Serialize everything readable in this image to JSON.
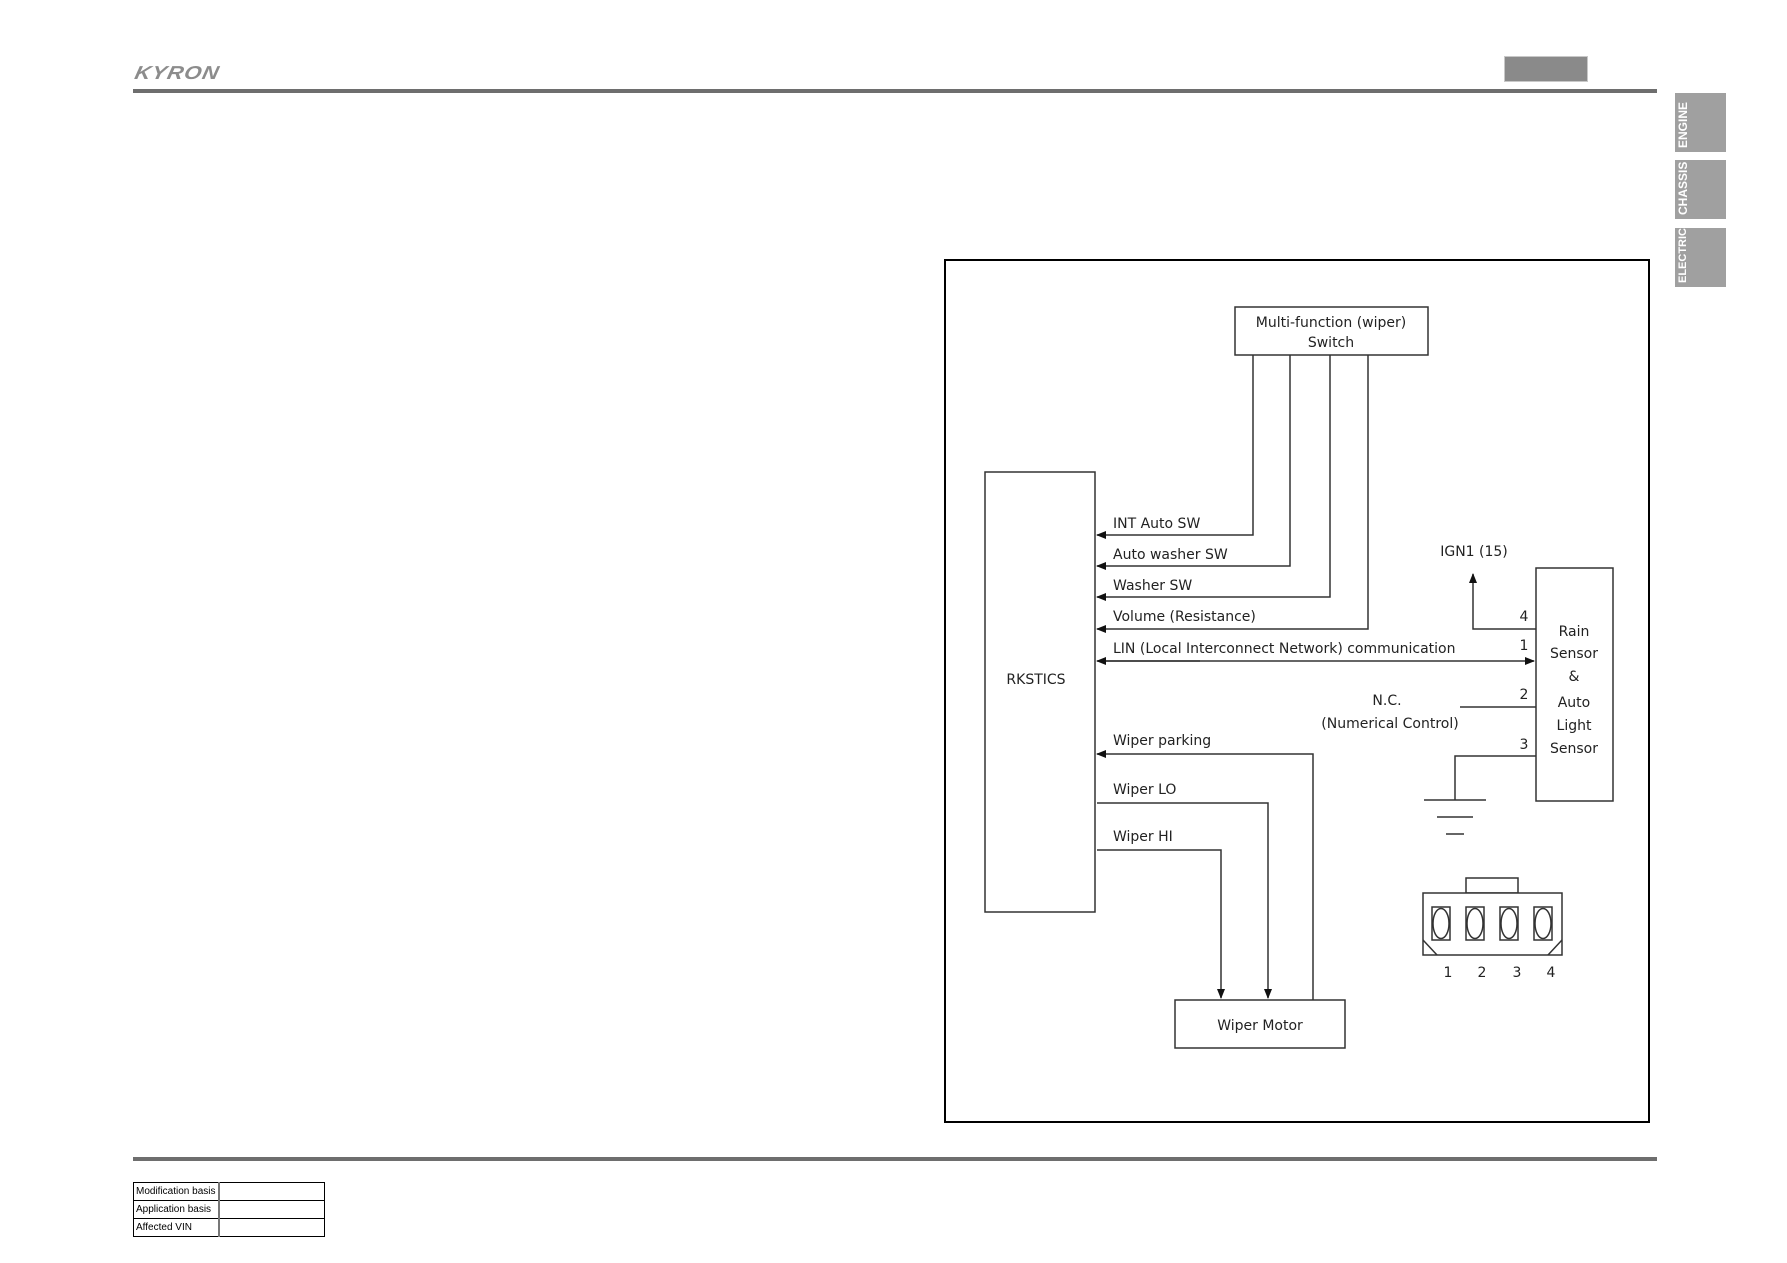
{
  "header": {
    "logo": "KYRON"
  },
  "side_tabs": [
    {
      "label": "ENGINE"
    },
    {
      "label": "CHASSIS"
    },
    {
      "label": "ELECTRIC"
    }
  ],
  "diagram": {
    "switch_box": {
      "line1": "Multi-function (wiper)",
      "line2": "Switch"
    },
    "control_unit": "RKSTICS",
    "signals": [
      {
        "label": "INT Auto SW"
      },
      {
        "label": "Auto washer SW"
      },
      {
        "label": "Washer SW"
      },
      {
        "label": "Volume (Resistance)"
      },
      {
        "label": "LIN (Local Interconnect Network) communication"
      }
    ],
    "motor_signals": [
      {
        "label": "Wiper parking"
      },
      {
        "label": "Wiper LO"
      },
      {
        "label": "Wiper HI"
      }
    ],
    "motor_box": "Wiper Motor",
    "sensor_box": {
      "lines": [
        "Rain",
        "Sensor",
        "&",
        "Auto",
        "Light",
        "Sensor"
      ]
    },
    "ign_label": "IGN1 (15)",
    "nc_label": {
      "line1": "N.C.",
      "line2": "(Numerical Control)"
    },
    "pins": {
      "p4": "4",
      "p1": "1",
      "p2": "2",
      "p3": "3"
    },
    "connector_pins": [
      "1",
      "2",
      "3",
      "4"
    ]
  },
  "footer_table": [
    {
      "label": "Modification basis",
      "value": ""
    },
    {
      "label": "Application basis",
      "value": ""
    },
    {
      "label": "Affected VIN",
      "value": ""
    }
  ]
}
